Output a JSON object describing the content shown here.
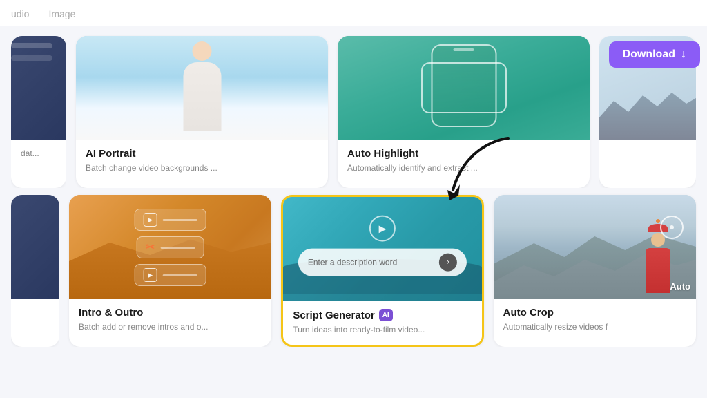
{
  "header": {
    "tabs": [
      {
        "label": "udio",
        "active": false
      },
      {
        "label": "Image",
        "active": false
      }
    ]
  },
  "download_btn": {
    "label": "Download",
    "icon": "↓"
  },
  "cards": {
    "row1": [
      {
        "id": "partial-left",
        "title": "",
        "desc": "dat...",
        "partial": true
      },
      {
        "id": "ai-portrait",
        "title": "AI Portrait",
        "desc": "Batch change video backgrounds ...",
        "ai_badge": false
      },
      {
        "id": "auto-highlight",
        "title": "Auto Highlight",
        "desc": "Automatically identify and extract ...",
        "ai_badge": false
      },
      {
        "id": "partial-right-1",
        "title": "",
        "desc": "",
        "partial": true
      }
    ],
    "row2": [
      {
        "id": "partial-left-2",
        "title": "",
        "desc": "",
        "partial": true
      },
      {
        "id": "intro-outro",
        "title": "Intro & Outro",
        "desc": "Batch add or remove intros and o...",
        "ai_badge": false
      },
      {
        "id": "script-generator",
        "title": "Script Generator",
        "desc": "Turn ideas into ready-to-film video...",
        "ai_badge": true,
        "highlighted": true,
        "input_placeholder": "Enter a description word"
      },
      {
        "id": "auto-crop",
        "title": "Auto Crop",
        "desc": "Automatically resize videos f",
        "ai_badge": false
      }
    ]
  }
}
